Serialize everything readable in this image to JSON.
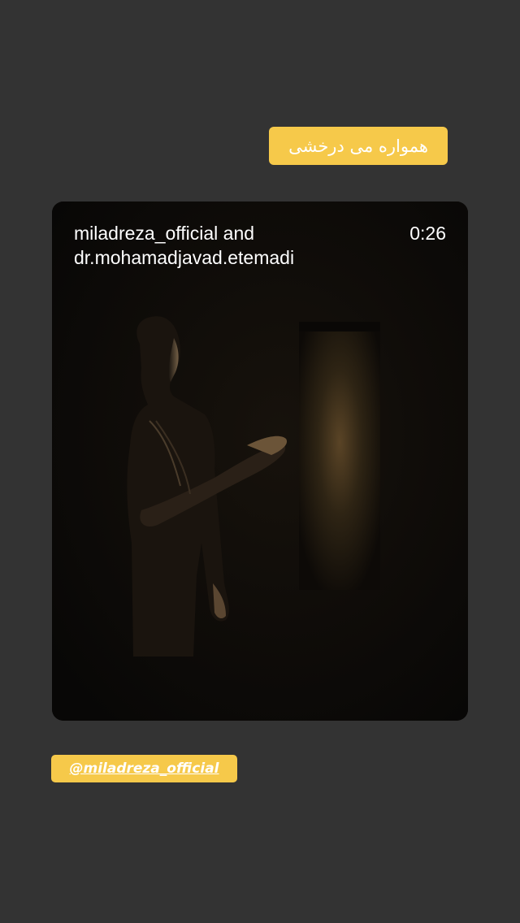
{
  "caption_sticker": {
    "text": "همواره می درخشی"
  },
  "reel": {
    "user_line_1": "miladreza_official and",
    "user_line_2": "dr.mohamadjavad.etemadi",
    "duration": "0:26"
  },
  "mention_sticker": {
    "text": "@miladreza_official"
  },
  "colors": {
    "background": "#333333",
    "sticker_yellow": "#f6c94a",
    "card_dark": "#0b0907"
  }
}
